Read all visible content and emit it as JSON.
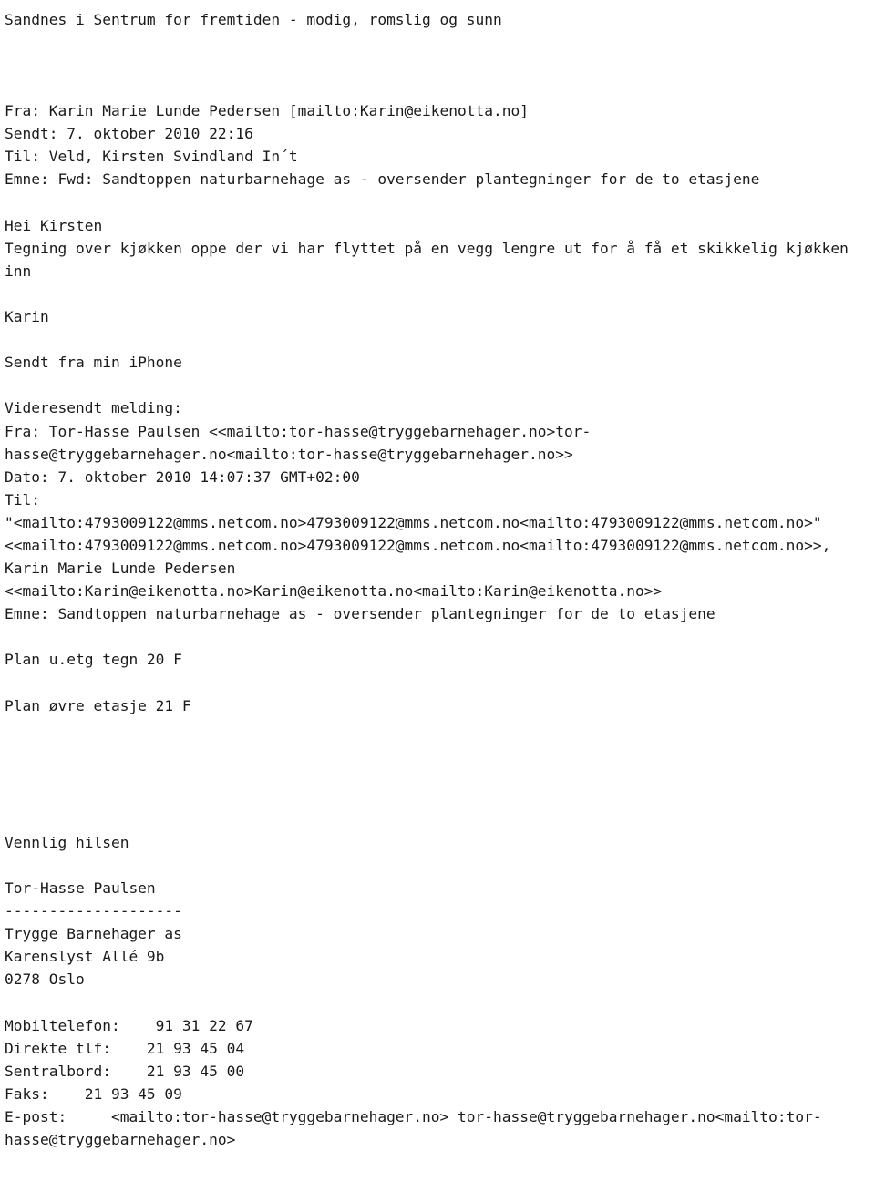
{
  "document": {
    "kind": "plain-text-email",
    "header_slogan": "Sandnes i Sentrum for fremtiden - modig, romslig og sunn",
    "outer_message": {
      "from_line": "Fra: Karin Marie Lunde Pedersen [mailto:Karin@eikenotta.no]",
      "sent_line": "Sendt: 7. oktober 2010 22:16",
      "to_line": "Til: Veld, Kirsten Svindland In´t",
      "subject_line": "Emne: Fwd: Sandtoppen naturbarnehage as - oversender plantegninger for de to etasjene"
    },
    "body": {
      "greeting": "Hei Kirsten",
      "paragraph": "Tegning over kjøkken oppe der vi har flyttet på en vegg lengre ut for å få et skikkelig kjøkken inn",
      "sign_name": "Karin",
      "sent_from": "Sendt fra min iPhone"
    },
    "forwarded": {
      "label": "Videresendt melding:",
      "from_line": "Fra: Tor-Hasse Paulsen <<mailto:tor-hasse@tryggebarnehager.no>tor-hasse@tryggebarnehager.no<mailto:tor-hasse@tryggebarnehager.no>>",
      "date_line": "Dato: 7. oktober 2010 14:07:37 GMT+02:00",
      "to_label": "Til:",
      "to_value_1": "\"<mailto:4793009122@mms.netcom.no>4793009122@mms.netcom.no<mailto:4793009122@mms.netcom.no>\"",
      "to_value_2": "<<mailto:4793009122@mms.netcom.no>4793009122@mms.netcom.no<mailto:4793009122@mms.netcom.no>>, Karin Marie Lunde Pedersen",
      "to_value_3": "<<mailto:Karin@eikenotta.no>Karin@eikenotta.no<mailto:Karin@eikenotta.no>>",
      "subject_line": "Emne: Sandtoppen naturbarnehage as - oversender plantegninger for de to etasjene"
    },
    "attachments": {
      "item_1": "Plan u.etg tegn 20 F",
      "item_2": "Plan øvre etasje 21 F"
    },
    "signature": {
      "closing": "Vennlig hilsen",
      "name": "Tor-Hasse Paulsen",
      "separator": "--------------------",
      "company": "Trygge Barnehager as",
      "street": "Karenslyst Allé 9b",
      "postal_city": "0278 Oslo",
      "mobile": "Mobiltelefon:    91 31 22 67",
      "direct": "Direkte tlf:    21 93 45 04",
      "switchboard": "Sentralbord:    21 93 45 00",
      "fax": "Faks:    21 93 45 09",
      "email": "E-post:     <mailto:tor-hasse@tryggebarnehager.no> tor-hasse@tryggebarnehager.no<mailto:tor-hasse@tryggebarnehager.no>"
    }
  }
}
